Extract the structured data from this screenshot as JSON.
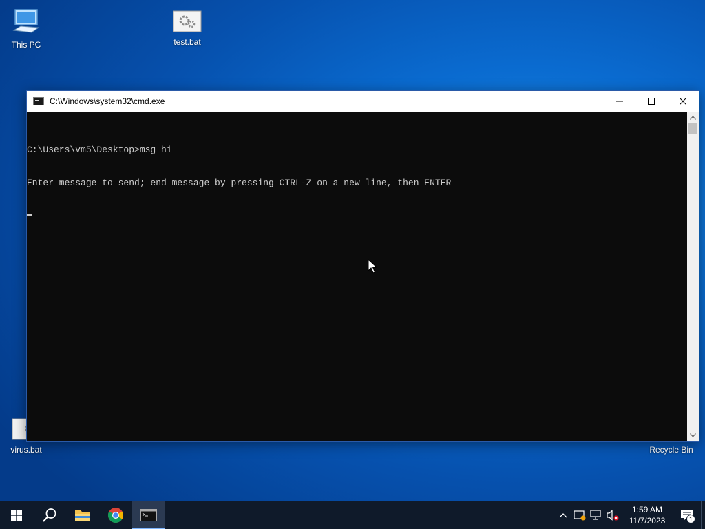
{
  "desktop": {
    "icons": [
      {
        "label": "This PC"
      },
      {
        "label": "test.bat"
      },
      {
        "label": "virus.bat"
      },
      {
        "label": "Recycle Bin"
      }
    ]
  },
  "window": {
    "title": "C:\\Windows\\system32\\cmd.exe",
    "console_lines": [
      "C:\\Users\\vm5\\Desktop>msg hi",
      "Enter message to send; end message by pressing CTRL-Z on a new line, then ENTER"
    ]
  },
  "taskbar": {
    "apps": [
      "start-icon",
      "search-icon",
      "file-explorer-icon",
      "chrome-icon",
      "cmd-icon"
    ],
    "clock_time": "1:59 AM",
    "clock_date": "11/7/2023",
    "notification_count": "1"
  },
  "colors": {
    "console_bg": "#0c0c0c",
    "console_fg": "#cccccc",
    "taskbar_bg": "#0f1a2a"
  }
}
